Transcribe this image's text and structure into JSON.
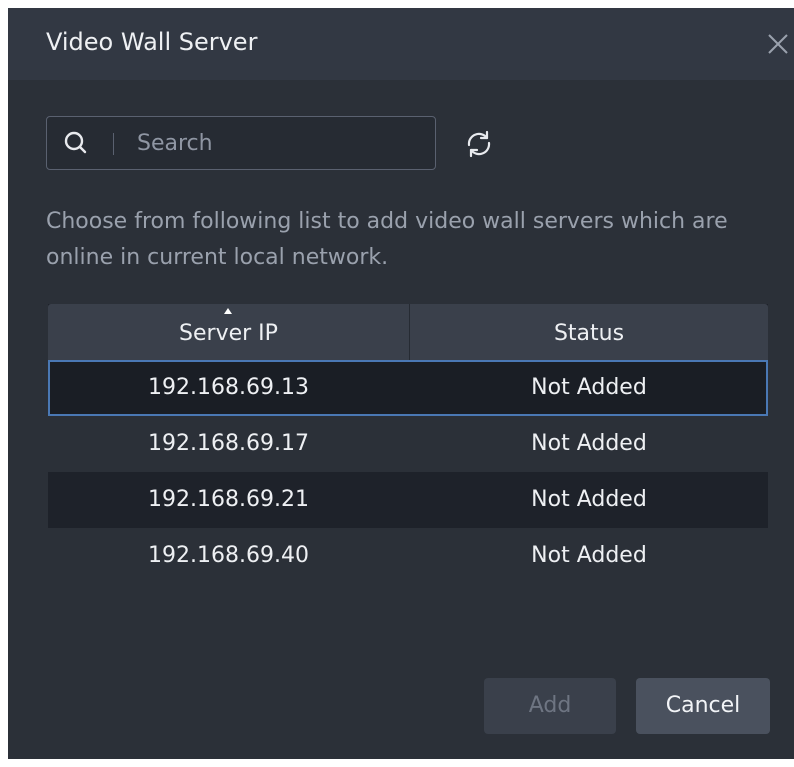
{
  "dialog": {
    "title": "Video Wall Server"
  },
  "icons": {
    "close": "close-icon",
    "search": "search-icon",
    "refresh": "refresh-icon",
    "sort": "sort-ascending-icon"
  },
  "search": {
    "placeholder": "Search",
    "value": ""
  },
  "description": "Choose from following list to add video wall servers which are online in current local network.",
  "table": {
    "columns": [
      "Server IP",
      "Status"
    ],
    "sort_column": "Server IP",
    "sort_direction": "ascending",
    "rows": [
      {
        "ip": "192.168.69.13",
        "status": "Not Added",
        "selected": true
      },
      {
        "ip": "192.168.69.17",
        "status": "Not Added",
        "selected": false
      },
      {
        "ip": "192.168.69.21",
        "status": "Not Added",
        "selected": false
      },
      {
        "ip": "192.168.69.40",
        "status": "Not Added",
        "selected": false
      }
    ]
  },
  "buttons": {
    "add": "Add",
    "add_enabled": false,
    "cancel": "Cancel"
  },
  "colors": {
    "dialog_bg": "#2b3038",
    "titlebar_bg": "#323843",
    "selection_border": "#4a78b4",
    "text": "#eef0f3",
    "muted_text": "#9aa1ad"
  }
}
